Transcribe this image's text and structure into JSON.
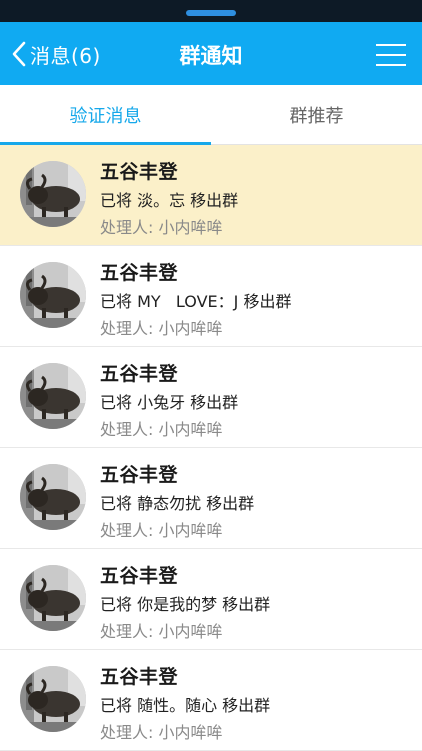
{
  "nav": {
    "back_label": "消息(6)",
    "title": "群通知"
  },
  "tabs": [
    {
      "label": "验证消息",
      "active": true
    },
    {
      "label": "群推荐",
      "active": false
    }
  ],
  "colors": {
    "accent": "#10aaf2",
    "tab_active": "#16a8ea",
    "highlight_row": "#fbf0c9"
  },
  "notices": [
    {
      "name": "五谷丰登",
      "action": "已将 淡。忘 移出群",
      "handler": "处理人:  小内哞哞",
      "highlighted": true
    },
    {
      "name": "五谷丰登",
      "action": "已将 MY   LOVE：J 移出群",
      "handler": "处理人:  小内哞哞",
      "highlighted": false
    },
    {
      "name": "五谷丰登",
      "action": "已将 小兔牙 移出群",
      "handler": "处理人:  小内哞哞",
      "highlighted": false
    },
    {
      "name": "五谷丰登",
      "action": "已将 静态勿扰 移出群",
      "handler": "处理人:  小内哞哞",
      "highlighted": false
    },
    {
      "name": "五谷丰登",
      "action": "已将 你是我的梦 移出群",
      "handler": "处理人:  小内哞哞",
      "highlighted": false
    },
    {
      "name": "五谷丰登",
      "action": "已将 随性。随心 移出群",
      "handler": "处理人:  小内哞哞",
      "highlighted": false
    }
  ]
}
